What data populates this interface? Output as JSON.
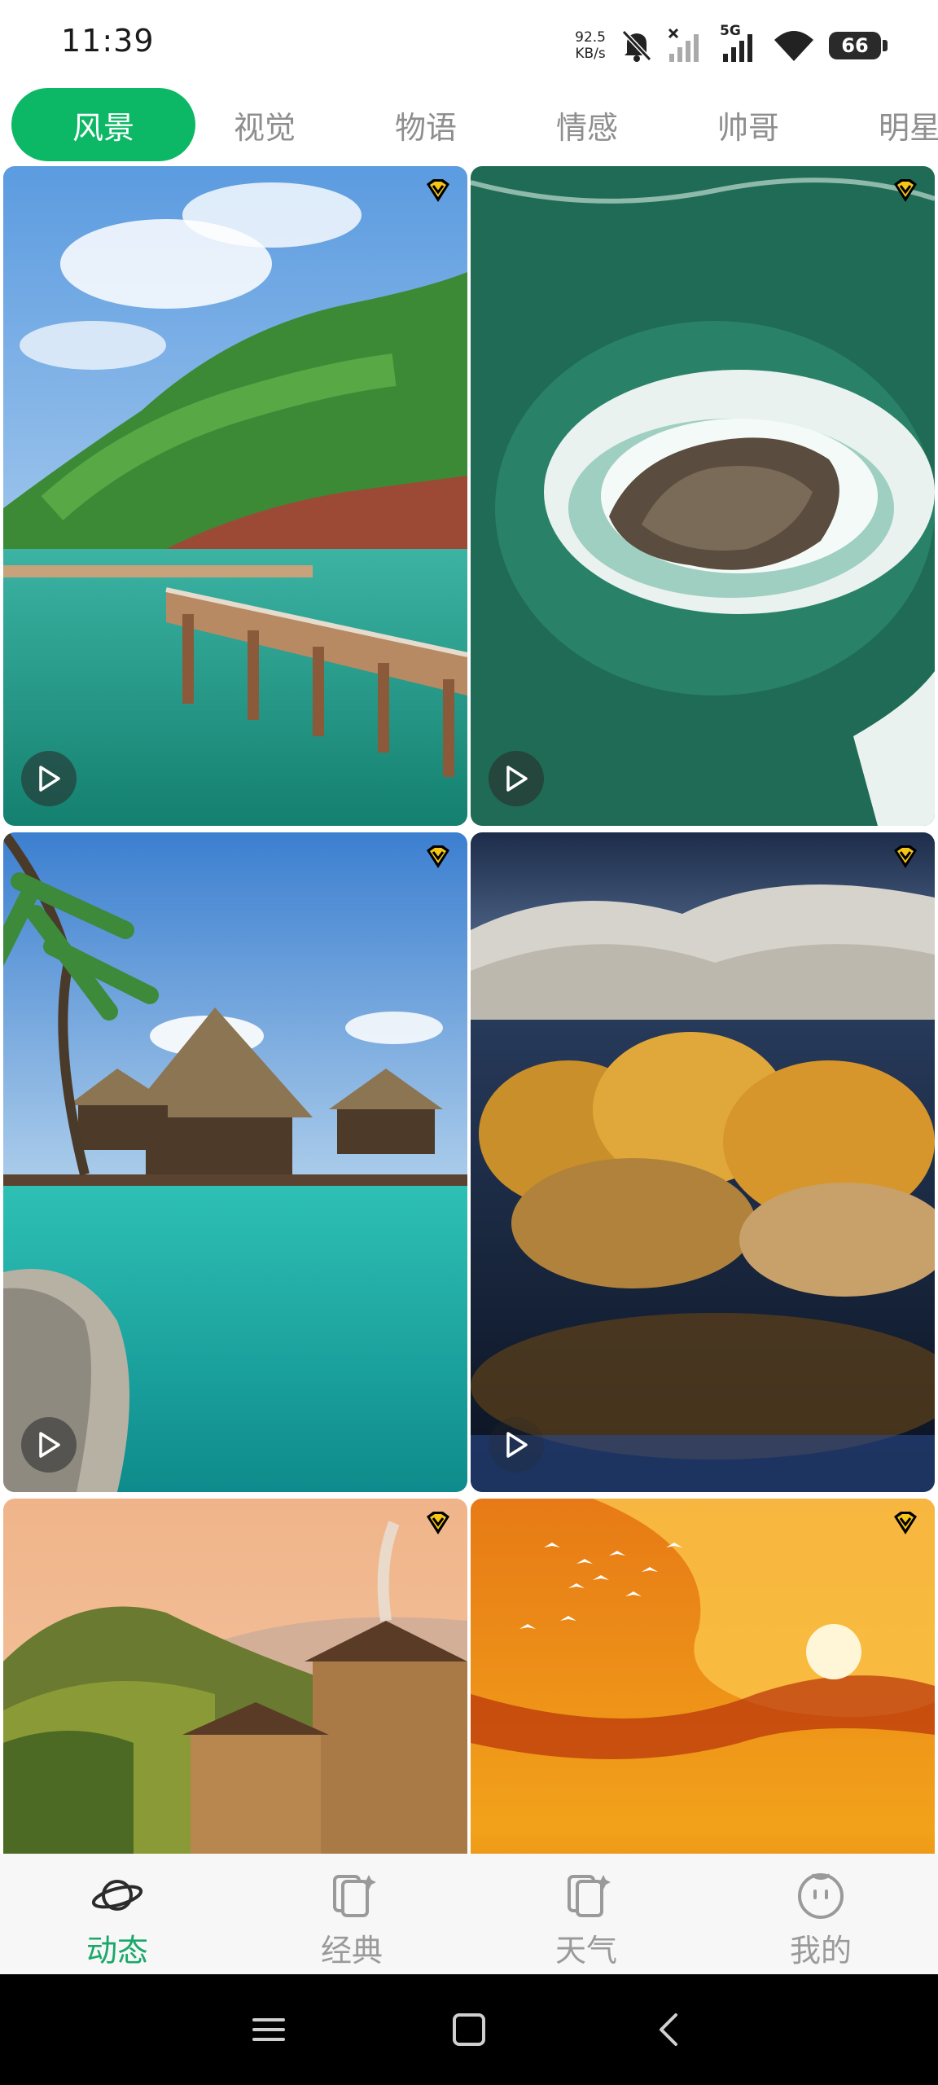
{
  "status_bar": {
    "time": "11:39",
    "net_speed_value": "92.5",
    "net_speed_unit": "KB/s",
    "network": "5G",
    "battery": "66",
    "icons": [
      "bell-muted-icon",
      "signal-off-icon",
      "signal-icon",
      "wifi-icon",
      "battery-icon"
    ]
  },
  "tabs": [
    {
      "label": "风景",
      "active": true
    },
    {
      "label": "视觉",
      "active": false
    },
    {
      "label": "物语",
      "active": false
    },
    {
      "label": "情感",
      "active": false
    },
    {
      "label": "帅哥",
      "active": false
    },
    {
      "label": "明星",
      "active": false
    }
  ],
  "cards": [
    {
      "scene": "wooden-pier-coast",
      "type": "video",
      "vip": true
    },
    {
      "scene": "ocean-rock-waves",
      "type": "video",
      "vip": true
    },
    {
      "scene": "overwater-bungalows",
      "type": "video",
      "vip": true
    },
    {
      "scene": "desert-lake-autumn",
      "type": "video",
      "vip": true
    },
    {
      "scene": "mountain-village-sunset",
      "type": "video",
      "vip": true
    },
    {
      "scene": "orange-sunset-birds",
      "type": "video",
      "vip": true
    }
  ],
  "bottom_nav": [
    {
      "label": "动态",
      "icon": "planet-icon",
      "active": true
    },
    {
      "label": "经典",
      "icon": "wallpaper-icon",
      "active": false
    },
    {
      "label": "天气",
      "icon": "wallpaper-sparkle-icon",
      "active": false
    },
    {
      "label": "我的",
      "icon": "face-icon",
      "active": false
    }
  ],
  "colors": {
    "accent": "#0cb865",
    "active_nav_label": "#1aa86a",
    "inactive_text": "#8e8e8e"
  }
}
